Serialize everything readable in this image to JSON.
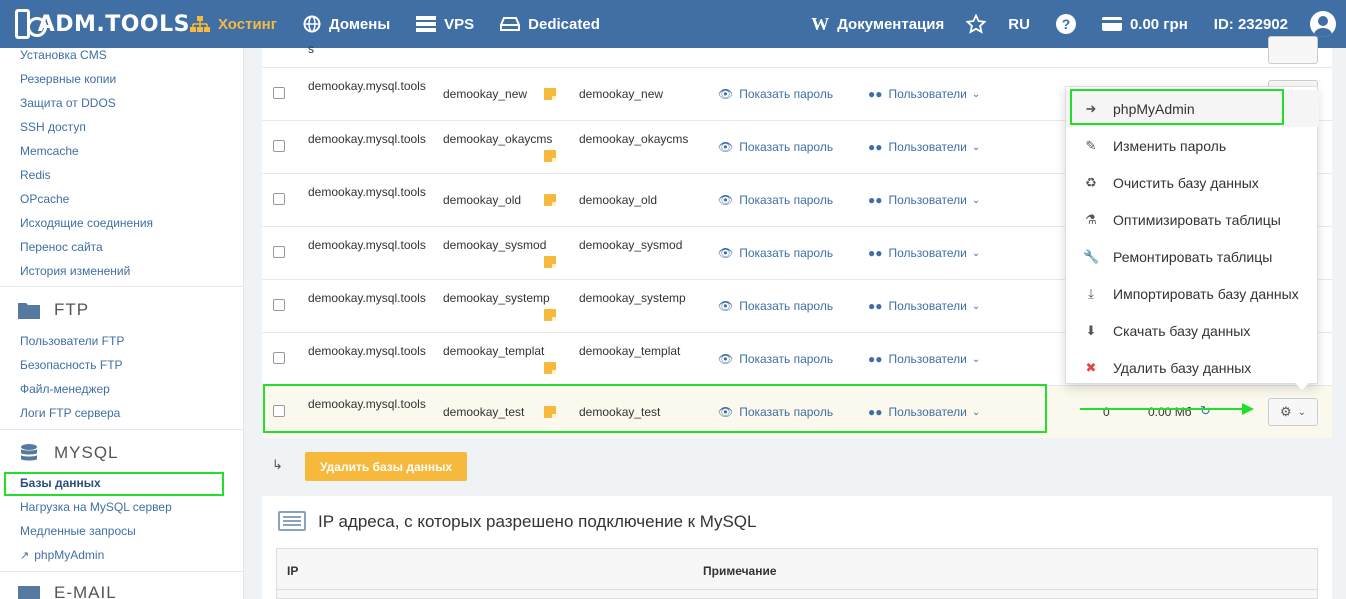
{
  "topbar": {
    "logo": "ADM.TOOLS",
    "nav": [
      {
        "label": "Хостинг",
        "icon": "sitemap-icon",
        "active": true
      },
      {
        "label": "Домены",
        "icon": "globe-icon",
        "active": false
      },
      {
        "label": "VPS",
        "icon": "server-icon",
        "active": false
      },
      {
        "label": "Dedicated",
        "icon": "hdd-icon",
        "active": false
      }
    ],
    "docs": "Документация",
    "lang": "RU",
    "balance": "0.00 грн",
    "account_id": "ID: 232902"
  },
  "sidebar": {
    "hosting_links": [
      "Установка CMS",
      "Резервные копии",
      "Защита от DDOS",
      "SSH доступ",
      "Memcache",
      "Redis",
      "OPcache",
      "Исходящие соединения",
      "Перенос сайта",
      "История изменений"
    ],
    "ftp_title": "FTP",
    "ftp_links": [
      "Пользователи FTP",
      "Безопасность FTP",
      "Файл-менеджер",
      "Логи FTP сервера"
    ],
    "mysql_title": "MYSQL",
    "mysql_links": [
      "Базы данных",
      "Нагрузка на MySQL сервер",
      "Медленные запросы",
      "phpMyAdmin"
    ],
    "email_title": "E-MAIL"
  },
  "table": {
    "show_password": "Показать пароль",
    "users_label": "Пользователи",
    "rows": [
      {
        "host": "demookay.mysql.tools",
        "db": "demookay_new",
        "user": "demookay_new"
      },
      {
        "host": "demookay.mysql.tools",
        "db": "demookay_okaycms",
        "user": "demookay_okaycms"
      },
      {
        "host": "demookay.mysql.tools",
        "db": "demookay_old",
        "user": "demookay_old"
      },
      {
        "host": "demookay.mysql.tools",
        "db": "demookay_sysmod",
        "user": "demookay_sysmod"
      },
      {
        "host": "demookay.mysql.tools",
        "db": "demookay_systemp",
        "user": "demookay_systemp"
      },
      {
        "host": "demookay.mysql.tools",
        "db": "demookay_templat",
        "user": "demookay_templat"
      },
      {
        "host": "demookay.mysql.tools",
        "db": "demookay_test",
        "user": "demookay_test"
      }
    ],
    "last_row_count": "0",
    "last_row_size": "0.00 Мб"
  },
  "dropdown": [
    {
      "label": "phpMyAdmin",
      "icon": "sign-in-icon"
    },
    {
      "label": "Изменить пароль",
      "icon": "edit-icon"
    },
    {
      "label": "Очистить базу данных",
      "icon": "recycle-icon"
    },
    {
      "label": "Оптимизировать таблицы",
      "icon": "flask-icon"
    },
    {
      "label": "Ремонтировать таблицы",
      "icon": "wrench-icon"
    },
    {
      "label": "Импортировать базу данных",
      "icon": "download-icon"
    },
    {
      "label": "Скачать базу данных",
      "icon": "circle-down-icon"
    },
    {
      "label": "Удалить базу данных",
      "icon": "delete-icon"
    }
  ],
  "delete_button": "Удалить базы данных",
  "ip_section": {
    "title": "IP адреса, с которых разрешено подключение к MySQL",
    "col_ip": "IP",
    "col_note": "Примечание"
  }
}
